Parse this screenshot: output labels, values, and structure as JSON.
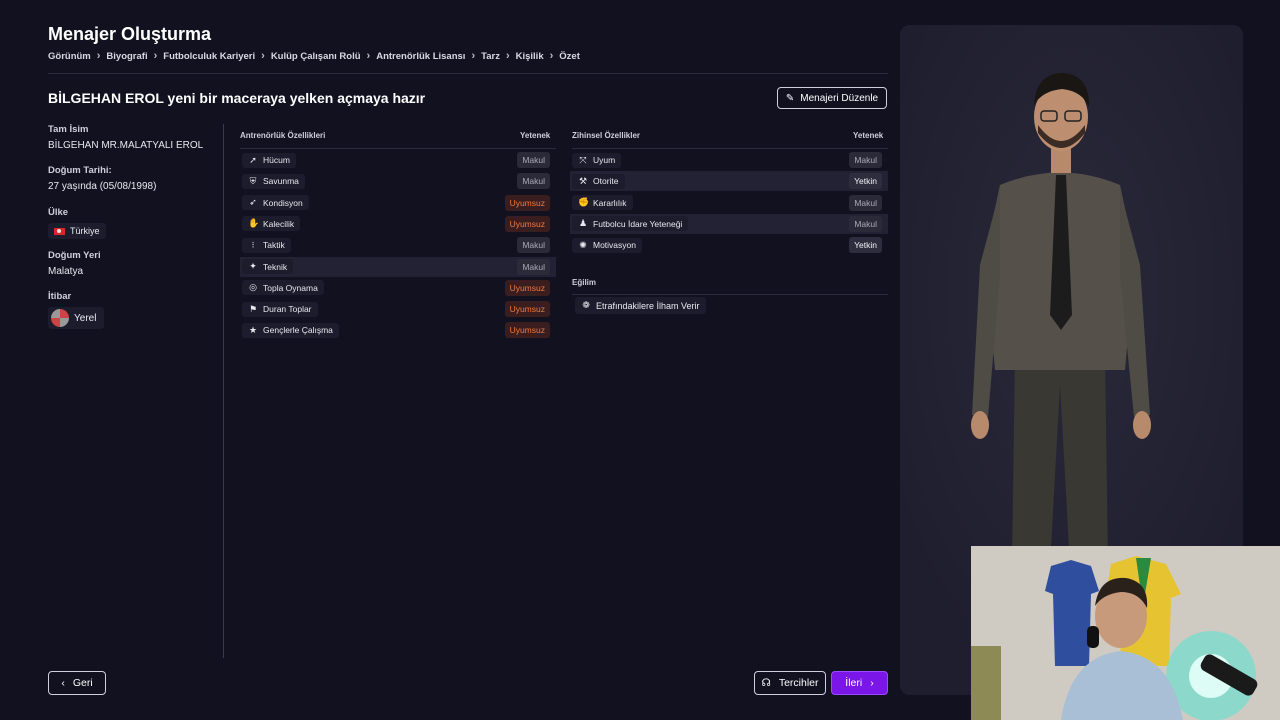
{
  "page": {
    "title": "Menajer Oluşturma",
    "breadcrumb": [
      "Görünüm",
      "Biyografi",
      "Futbolculuk Kariyeri",
      "Kulüp Çalışanı Rolü",
      "Antrenörlük Lisansı",
      "Tarz",
      "Kişilik",
      "Özet"
    ],
    "headline": "BİLGEHAN EROL yeni bir maceraya yelken açmaya hazır",
    "edit_button": "Menajeri Düzenle"
  },
  "profile": {
    "full_name_label": "Tam İsim",
    "full_name": "BİLGEHAN MR.MALATYALI EROL",
    "birth_label": "Doğum Tarihi:",
    "birth_age": "27 yaşında",
    "birth_date": "(05/08/1998)",
    "country_label": "Ülke",
    "country": "Türkiye",
    "birthplace_label": "Doğum Yeri",
    "birthplace": "Malatya",
    "reputation_label": "İtibar",
    "reputation": "Yerel"
  },
  "coaching": {
    "header": "Antrenörlük Özellikleri",
    "rating_header": "Yetenek",
    "rows": [
      {
        "name": "Hücum",
        "rating": "Makul",
        "icon": "attack-icon"
      },
      {
        "name": "Savunma",
        "rating": "Makul",
        "icon": "defense-icon"
      },
      {
        "name": "Kondisyon",
        "rating": "Uyumsuz",
        "icon": "fitness-icon"
      },
      {
        "name": "Kalecilik",
        "rating": "Uyumsuz",
        "icon": "goalkeeping-icon"
      },
      {
        "name": "Taktik",
        "rating": "Makul",
        "icon": "tactics-icon"
      },
      {
        "name": "Teknik",
        "rating": "Makul",
        "icon": "technique-icon"
      },
      {
        "name": "Topla Oynama",
        "rating": "Uyumsuz",
        "icon": "ball-control-icon"
      },
      {
        "name": "Duran Toplar",
        "rating": "Uyumsuz",
        "icon": "set-pieces-icon"
      },
      {
        "name": "Gençlerle Çalışma",
        "rating": "Uyumsuz",
        "icon": "youth-star-icon"
      }
    ]
  },
  "mental": {
    "header": "Zihinsel Özellikler",
    "rating_header": "Yetenek",
    "rows": [
      {
        "name": "Uyum",
        "rating": "Makul",
        "icon": "adaptability-icon"
      },
      {
        "name": "Otorite",
        "rating": "Yetkin",
        "icon": "authority-icon"
      },
      {
        "name": "Kararlılık",
        "rating": "Makul",
        "icon": "determination-icon"
      },
      {
        "name": "Futbolcu İdare Yeteneği",
        "rating": "Makul",
        "icon": "man-management-icon"
      },
      {
        "name": "Motivasyon",
        "rating": "Yetkin",
        "icon": "motivation-icon"
      }
    ]
  },
  "tendency": {
    "header": "Eğilim",
    "trait": "Etrafındakilere İlham Verir"
  },
  "footer": {
    "back": "Geri",
    "preferences": "Tercihler",
    "next": "İleri"
  },
  "colors": {
    "background": "#12111f",
    "accent": "#7b16e8",
    "uyumsuz": "#f0773a"
  }
}
